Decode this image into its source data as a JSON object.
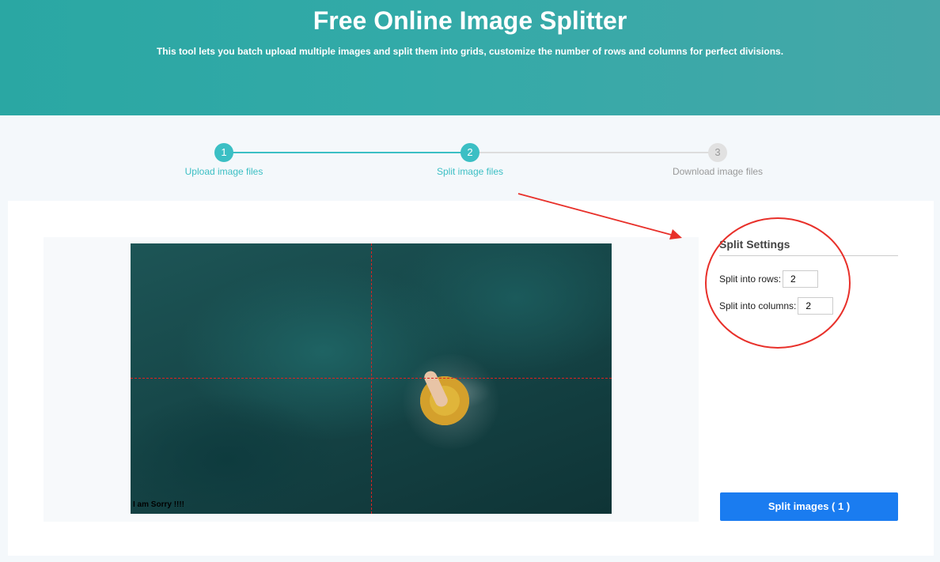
{
  "header": {
    "title": "Free Online Image Splitter",
    "subtitle": "This tool lets you batch upload multiple images and split them into grids, customize the number of rows and columns for perfect divisions."
  },
  "steps": [
    {
      "number": "1",
      "label": "Upload image files",
      "state": "done"
    },
    {
      "number": "2",
      "label": "Split image files",
      "state": "active"
    },
    {
      "number": "3",
      "label": "Download image files",
      "state": "pending"
    }
  ],
  "preview": {
    "watermark_text": "I am Sorry !!!!"
  },
  "settings": {
    "title": "Split Settings",
    "rows_label": "Split into rows:",
    "rows_value": "2",
    "columns_label": "Split into columns:",
    "columns_value": "2"
  },
  "actions": {
    "split_button": "Split images ( 1 )"
  },
  "colors": {
    "accent": "#3bbfc4",
    "button": "#1a7cf0",
    "annotation": "#e8302a"
  }
}
